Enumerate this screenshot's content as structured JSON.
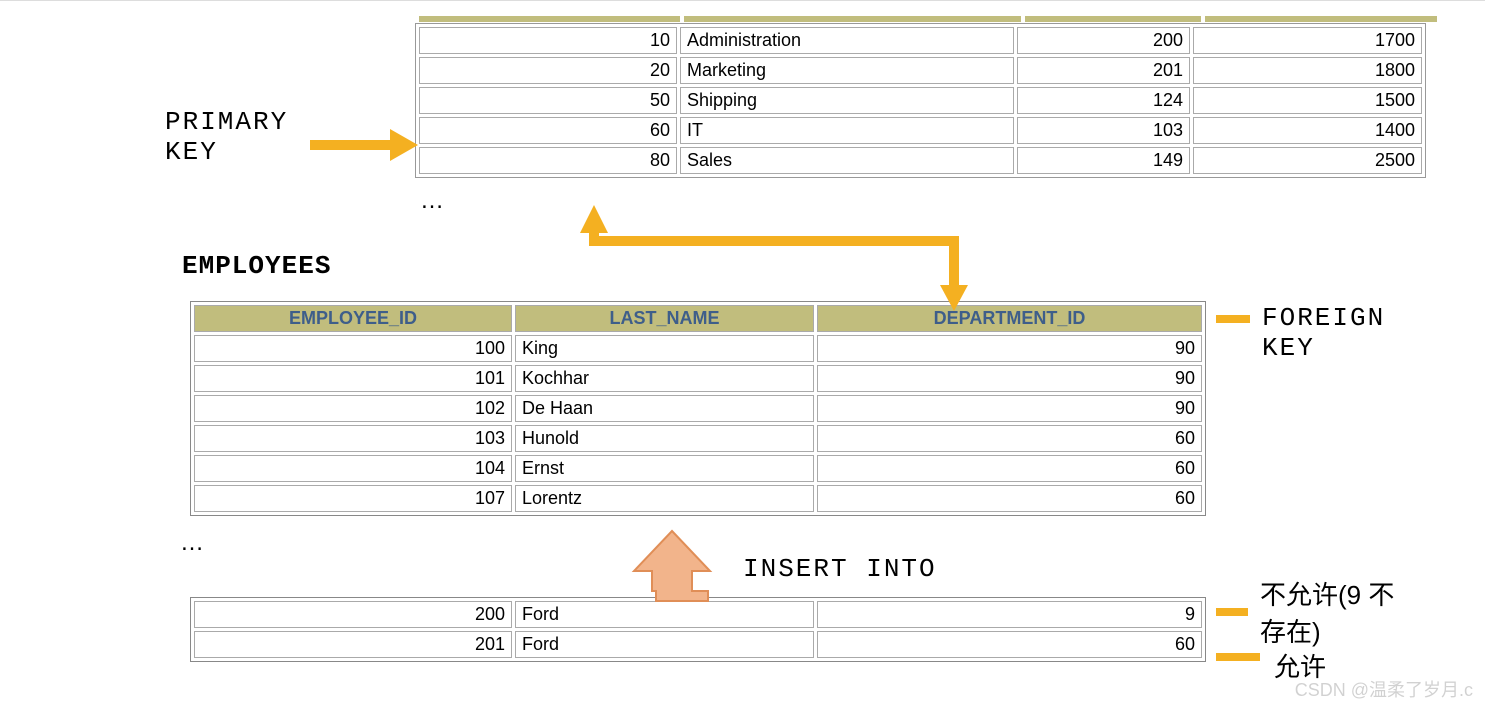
{
  "labels": {
    "primary_key_line1": "PRIMARY",
    "primary_key_line2": "KEY",
    "foreign_key_line1": "FOREIGN",
    "foreign_key_line2": "KEY",
    "employees_title": "EMPLOYEES",
    "insert_into": "INSERT INTO",
    "not_allowed_line1": "不允许(9 不",
    "not_allowed_line2": "存在)",
    "allowed": "允许",
    "ellipsis_top": "…",
    "ellipsis_mid": "…"
  },
  "top_table": {
    "rows": [
      {
        "c1": "10",
        "c2": "Administration",
        "c3": "200",
        "c4": "1700"
      },
      {
        "c1": "20",
        "c2": "Marketing",
        "c3": "201",
        "c4": "1800"
      },
      {
        "c1": "50",
        "c2": "Shipping",
        "c3": "124",
        "c4": "1500"
      },
      {
        "c1": "60",
        "c2": "IT",
        "c3": "103",
        "c4": "1400"
      },
      {
        "c1": "80",
        "c2": "Sales",
        "c3": "149",
        "c4": "2500"
      }
    ]
  },
  "employees_table": {
    "headers": {
      "h1": "EMPLOYEE_ID",
      "h2": "LAST_NAME",
      "h3": "DEPARTMENT_ID"
    },
    "rows": [
      {
        "id": "100",
        "name": "King",
        "dept": "90"
      },
      {
        "id": "101",
        "name": "Kochhar",
        "dept": "90"
      },
      {
        "id": "102",
        "name": "De Haan",
        "dept": "90"
      },
      {
        "id": "103",
        "name": "Hunold",
        "dept": "60"
      },
      {
        "id": "104",
        "name": "Ernst",
        "dept": "60"
      },
      {
        "id": "107",
        "name": "Lorentz",
        "dept": "60"
      }
    ]
  },
  "insert_table": {
    "rows": [
      {
        "id": "200",
        "name": "Ford",
        "dept": "9"
      },
      {
        "id": "201",
        "name": "Ford",
        "dept": "60"
      }
    ]
  },
  "watermark": "CSDN @温柔了岁月.c"
}
